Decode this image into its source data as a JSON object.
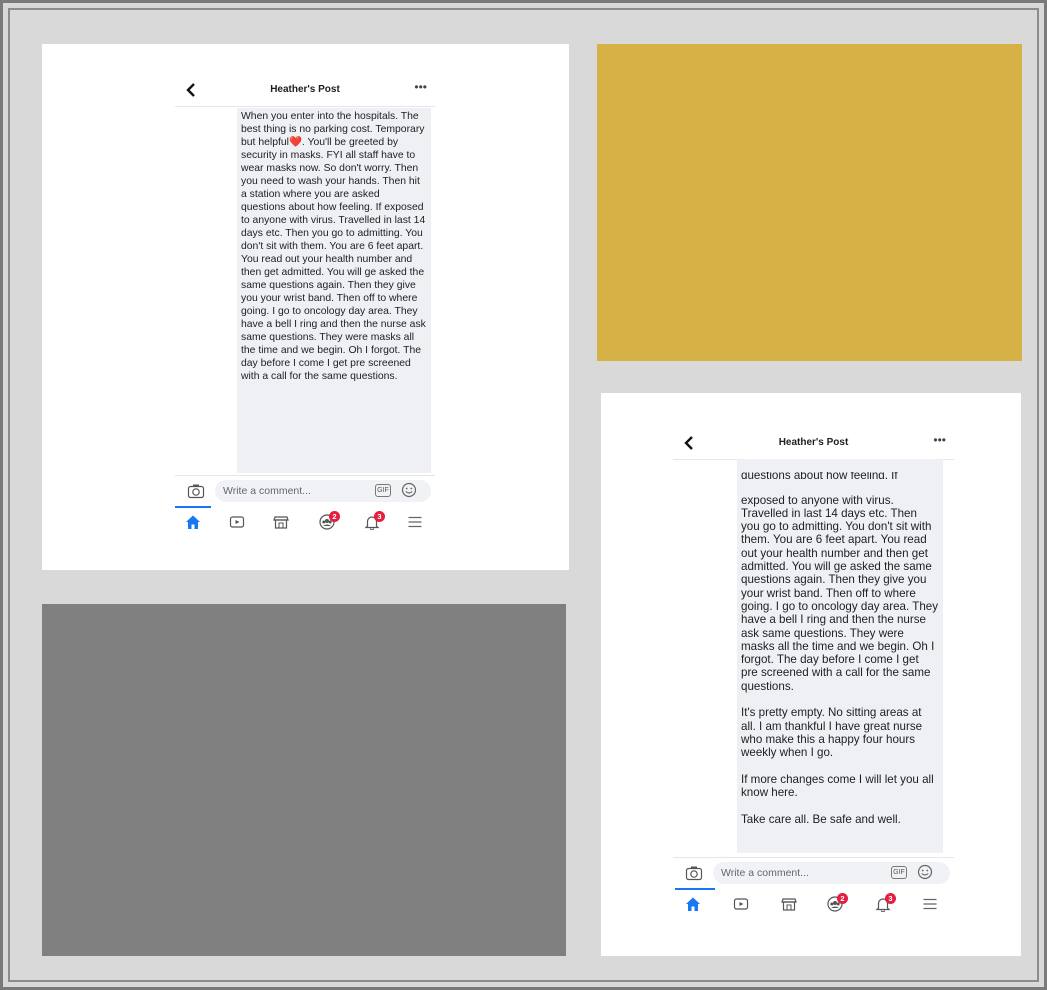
{
  "colors": {
    "background": "#d9d9d9",
    "gold_tile": "#d6b146",
    "gray_tile": "#808080",
    "facebook_blue": "#1877f2",
    "badge_red": "#e41e3f",
    "bubble_bg": "#eff0f3"
  },
  "screenshot_a": {
    "header": {
      "title": "Heather's Post",
      "back_icon": "chevron-left-icon",
      "more_icon": "more-horizontal-icon",
      "more_glyph": "•••"
    },
    "bubble_text": "When you enter into the hospitals. The best thing is no parking cost. Temporary but helpful❤️.  You'll be greeted by security in masks. FYI all staff have to wear masks now. So don't worry.  Then  you need to wash your hands.   Then hit a station where you are asked questions about how feeling. If exposed to anyone with virus. Travelled in last 14 days etc.  Then you go to admitting. You don't sit with them. You are 6 feet apart. You read out your health number and then get admitted. You will ge asked the same questions again. Then they give you your wrist band.  Then off to where going. I go to oncology day area.  They have a bell I ring and then the nurse ask same questions. They were masks all the time and we begin.   Oh I forgot. The day before I come I get pre screened with a call for the same questions.",
    "comment_placeholder": "Write a comment...",
    "gif_label": "GIF",
    "nav": {
      "items": [
        "home-icon",
        "watch-icon",
        "marketplace-icon",
        "groups-icon",
        "notifications-icon",
        "menu-icon"
      ],
      "groups_badge": "2",
      "notifications_badge": "3"
    }
  },
  "screenshot_b": {
    "header": {
      "title": "Heather's Post",
      "back_icon": "chevron-left-icon",
      "more_icon": "more-horizontal-icon",
      "more_glyph": "•••"
    },
    "bubble_cut_line": "questions about how feeling. If",
    "bubble_text": "exposed to anyone with virus. Travelled in last 14 days etc.  Then you go to admitting. You don't sit with them. You are 6 feet apart. You read out your health number and then get admitted. You will ge asked the same questions again. Then they give you your wrist band.  Then off to where going. I go to oncology day area.  They have a bell I ring and then the nurse ask same questions. They were masks all the time and we begin.   Oh I forgot. The day before I come I get pre screened with a call for the same questions.\n\nIt's pretty empty. No sitting areas at all.  I am thankful I have great nurse who make this a happy four hours weekly when I go.\n\nIf more changes come I will let you all know here.\n\nTake care all. Be safe and well.",
    "comment_placeholder": "Write a comment...",
    "gif_label": "GIF",
    "nav": {
      "items": [
        "home-icon",
        "watch-icon",
        "marketplace-icon",
        "groups-icon",
        "notifications-icon",
        "menu-icon"
      ],
      "groups_badge": "2",
      "notifications_badge": "3"
    }
  }
}
